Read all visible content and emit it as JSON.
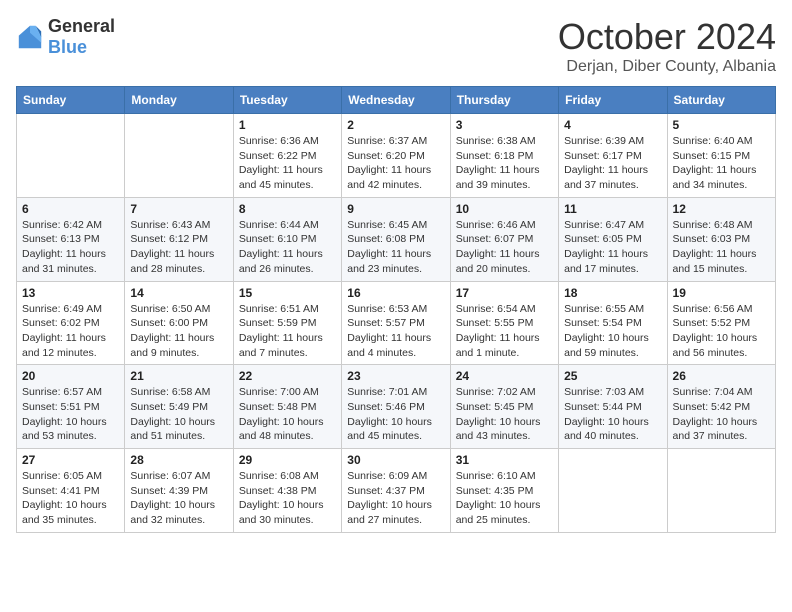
{
  "header": {
    "logo": {
      "general": "General",
      "blue": "Blue"
    },
    "month": "October 2024",
    "location": "Derjan, Diber County, Albania"
  },
  "weekdays": [
    "Sunday",
    "Monday",
    "Tuesday",
    "Wednesday",
    "Thursday",
    "Friday",
    "Saturday"
  ],
  "weeks": [
    [
      null,
      null,
      {
        "day": 1,
        "sunrise": "6:36 AM",
        "sunset": "6:22 PM",
        "daylight": "11 hours and 45 minutes."
      },
      {
        "day": 2,
        "sunrise": "6:37 AM",
        "sunset": "6:20 PM",
        "daylight": "11 hours and 42 minutes."
      },
      {
        "day": 3,
        "sunrise": "6:38 AM",
        "sunset": "6:18 PM",
        "daylight": "11 hours and 39 minutes."
      },
      {
        "day": 4,
        "sunrise": "6:39 AM",
        "sunset": "6:17 PM",
        "daylight": "11 hours and 37 minutes."
      },
      {
        "day": 5,
        "sunrise": "6:40 AM",
        "sunset": "6:15 PM",
        "daylight": "11 hours and 34 minutes."
      }
    ],
    [
      {
        "day": 6,
        "sunrise": "6:42 AM",
        "sunset": "6:13 PM",
        "daylight": "11 hours and 31 minutes."
      },
      {
        "day": 7,
        "sunrise": "6:43 AM",
        "sunset": "6:12 PM",
        "daylight": "11 hours and 28 minutes."
      },
      {
        "day": 8,
        "sunrise": "6:44 AM",
        "sunset": "6:10 PM",
        "daylight": "11 hours and 26 minutes."
      },
      {
        "day": 9,
        "sunrise": "6:45 AM",
        "sunset": "6:08 PM",
        "daylight": "11 hours and 23 minutes."
      },
      {
        "day": 10,
        "sunrise": "6:46 AM",
        "sunset": "6:07 PM",
        "daylight": "11 hours and 20 minutes."
      },
      {
        "day": 11,
        "sunrise": "6:47 AM",
        "sunset": "6:05 PM",
        "daylight": "11 hours and 17 minutes."
      },
      {
        "day": 12,
        "sunrise": "6:48 AM",
        "sunset": "6:03 PM",
        "daylight": "11 hours and 15 minutes."
      }
    ],
    [
      {
        "day": 13,
        "sunrise": "6:49 AM",
        "sunset": "6:02 PM",
        "daylight": "11 hours and 12 minutes."
      },
      {
        "day": 14,
        "sunrise": "6:50 AM",
        "sunset": "6:00 PM",
        "daylight": "11 hours and 9 minutes."
      },
      {
        "day": 15,
        "sunrise": "6:51 AM",
        "sunset": "5:59 PM",
        "daylight": "11 hours and 7 minutes."
      },
      {
        "day": 16,
        "sunrise": "6:53 AM",
        "sunset": "5:57 PM",
        "daylight": "11 hours and 4 minutes."
      },
      {
        "day": 17,
        "sunrise": "6:54 AM",
        "sunset": "5:55 PM",
        "daylight": "11 hours and 1 minute."
      },
      {
        "day": 18,
        "sunrise": "6:55 AM",
        "sunset": "5:54 PM",
        "daylight": "10 hours and 59 minutes."
      },
      {
        "day": 19,
        "sunrise": "6:56 AM",
        "sunset": "5:52 PM",
        "daylight": "10 hours and 56 minutes."
      }
    ],
    [
      {
        "day": 20,
        "sunrise": "6:57 AM",
        "sunset": "5:51 PM",
        "daylight": "10 hours and 53 minutes."
      },
      {
        "day": 21,
        "sunrise": "6:58 AM",
        "sunset": "5:49 PM",
        "daylight": "10 hours and 51 minutes."
      },
      {
        "day": 22,
        "sunrise": "7:00 AM",
        "sunset": "5:48 PM",
        "daylight": "10 hours and 48 minutes."
      },
      {
        "day": 23,
        "sunrise": "7:01 AM",
        "sunset": "5:46 PM",
        "daylight": "10 hours and 45 minutes."
      },
      {
        "day": 24,
        "sunrise": "7:02 AM",
        "sunset": "5:45 PM",
        "daylight": "10 hours and 43 minutes."
      },
      {
        "day": 25,
        "sunrise": "7:03 AM",
        "sunset": "5:44 PM",
        "daylight": "10 hours and 40 minutes."
      },
      {
        "day": 26,
        "sunrise": "7:04 AM",
        "sunset": "5:42 PM",
        "daylight": "10 hours and 37 minutes."
      }
    ],
    [
      {
        "day": 27,
        "sunrise": "6:05 AM",
        "sunset": "4:41 PM",
        "daylight": "10 hours and 35 minutes."
      },
      {
        "day": 28,
        "sunrise": "6:07 AM",
        "sunset": "4:39 PM",
        "daylight": "10 hours and 32 minutes."
      },
      {
        "day": 29,
        "sunrise": "6:08 AM",
        "sunset": "4:38 PM",
        "daylight": "10 hours and 30 minutes."
      },
      {
        "day": 30,
        "sunrise": "6:09 AM",
        "sunset": "4:37 PM",
        "daylight": "10 hours and 27 minutes."
      },
      {
        "day": 31,
        "sunrise": "6:10 AM",
        "sunset": "4:35 PM",
        "daylight": "10 hours and 25 minutes."
      },
      null,
      null
    ]
  ]
}
